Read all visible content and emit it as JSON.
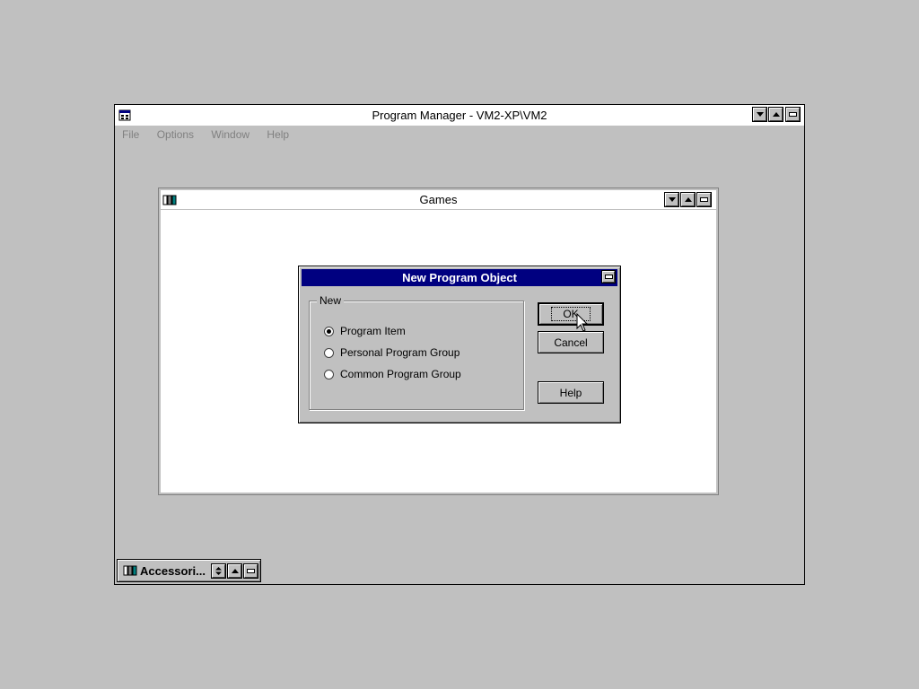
{
  "program_manager": {
    "title": "Program Manager - VM2-XP\\VM2",
    "menu": [
      "File",
      "Options",
      "Window",
      "Help"
    ]
  },
  "games_window": {
    "title": "Games"
  },
  "dialog": {
    "title": "New Program Object",
    "group_label": "New",
    "options": [
      {
        "label": "Program Item",
        "selected": true
      },
      {
        "label": "Personal Program Group",
        "selected": false
      },
      {
        "label": "Common Program Group",
        "selected": false
      }
    ],
    "ok_label": "OK",
    "cancel_label": "Cancel",
    "help_label": "Help"
  },
  "minimized_group": {
    "label": "Accessori..."
  },
  "colors": {
    "desktop": "#c0c0c0",
    "active_title": "#000080",
    "inactive_title": "#ffffff"
  }
}
